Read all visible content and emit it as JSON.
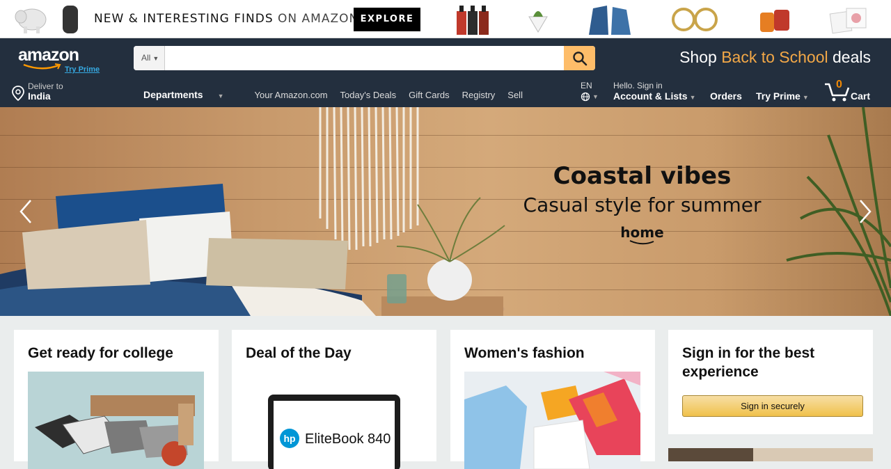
{
  "promo": {
    "text_main": "NEW & INTERESTING FINDS ",
    "text_light": "ON AMAZON",
    "explore_label": "EXPLORE"
  },
  "header": {
    "logo_text": "amazon",
    "try_prime_link": "Try Prime",
    "search": {
      "category": "All",
      "placeholder": "",
      "value": ""
    },
    "promo_prefix": "Shop ",
    "promo_highlight": "Back to School",
    "promo_suffix": " deals"
  },
  "subnav": {
    "deliver_small": "Deliver to",
    "deliver_big": "India",
    "departments": "Departments",
    "links": [
      "Your Amazon.com",
      "Today's Deals",
      "Gift Cards",
      "Registry",
      "Sell"
    ],
    "language": "EN",
    "account_small": "Hello. Sign in",
    "account_big": "Account & Lists",
    "orders": "Orders",
    "try_prime": "Try Prime",
    "cart_count": "0",
    "cart_label": "Cart"
  },
  "hero": {
    "title": "Coastal vibes",
    "subtitle": "Casual style for summer",
    "brand": "home"
  },
  "cards": {
    "college": "Get ready for college",
    "deal": "Deal of the Day",
    "deal_product": "EliteBook 840",
    "fashion": "Women's fashion",
    "signin_title": "Sign in for the best experience",
    "signin_button": "Sign in securely"
  },
  "colors": {
    "nav_bg": "#232f3e",
    "accent": "#febd69",
    "highlight": "#f3a847"
  }
}
